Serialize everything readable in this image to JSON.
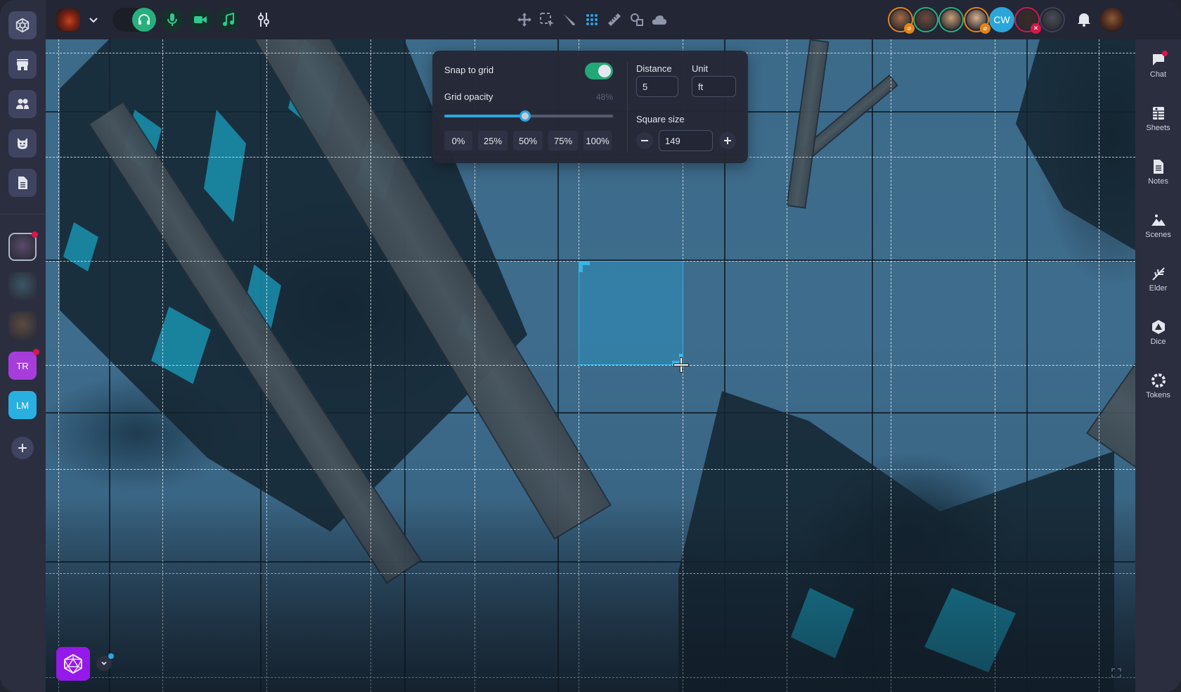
{
  "topbar": {
    "game_avatar": "game-avatar-dragon",
    "media": {
      "headphones": {
        "icon": "headphones-icon",
        "active": true
      },
      "microphone": {
        "icon": "microphone-icon",
        "active": false
      },
      "camera": {
        "icon": "video-camera-icon",
        "active": false
      },
      "music": {
        "icon": "music-note-icon",
        "active": false
      }
    },
    "mixer_icon": "sliders-icon",
    "tools": [
      {
        "name": "move",
        "icon": "move-icon",
        "active": false
      },
      {
        "name": "select",
        "icon": "select-icon",
        "active": false
      },
      {
        "name": "draw",
        "icon": "brush-icon",
        "active": false
      },
      {
        "name": "grid",
        "icon": "grid-icon",
        "active": true
      },
      {
        "name": "measure",
        "icon": "ruler-icon",
        "active": false
      },
      {
        "name": "shapes",
        "icon": "shapes-icon",
        "active": false
      },
      {
        "name": "fog",
        "icon": "cloud-icon",
        "active": false
      }
    ],
    "players": [
      {
        "type": "photo",
        "ring": "#e3841a",
        "status": "mic-muted",
        "badge_color": "#e3841a"
      },
      {
        "type": "photo",
        "ring": "#27b07e",
        "status": "speaking"
      },
      {
        "type": "photo",
        "ring": "#27b07e",
        "status": "speaking"
      },
      {
        "type": "photo",
        "ring": "#e3841a",
        "status": "mic-muted",
        "badge_color": "#e3841a"
      },
      {
        "type": "initials",
        "initials": "CW",
        "ring": "#2aa6d9"
      },
      {
        "type": "photo",
        "ring": "#d8174a",
        "status": "sound-muted",
        "badge_color": "#d8174a"
      },
      {
        "type": "photo",
        "ring": "#3e4258",
        "status": "offline"
      }
    ],
    "bell_icon": "bell-icon",
    "current_user_avatar": "avatar"
  },
  "left_sidebar": {
    "nav": [
      {
        "name": "store",
        "icon": "store-icon"
      },
      {
        "name": "players",
        "icon": "users-icon"
      },
      {
        "name": "monsters",
        "icon": "monster-icon"
      },
      {
        "name": "documents",
        "icon": "document-icon"
      }
    ],
    "characters": [
      {
        "kind": "portrait",
        "selected": true,
        "notification": true,
        "color": "#5a4a6a"
      },
      {
        "kind": "portrait",
        "selected": false,
        "notification": false,
        "color": "#3b5666"
      },
      {
        "kind": "portrait",
        "selected": false,
        "notification": false,
        "color": "#5b4a40"
      },
      {
        "kind": "initials",
        "initials": "TR",
        "color": "#a63ddb",
        "notification": true
      },
      {
        "kind": "initials",
        "initials": "LM",
        "color": "#2ab0e0",
        "notification": false
      }
    ],
    "add_label": "+"
  },
  "right_sidebar": {
    "items": [
      {
        "label": "Chat",
        "icon": "chat-icon",
        "notification": true
      },
      {
        "label": "Sheets",
        "icon": "sheets-icon",
        "notification": false
      },
      {
        "label": "Notes",
        "icon": "notes-icon",
        "notification": false
      },
      {
        "label": "Scenes",
        "icon": "scenes-icon",
        "notification": false
      },
      {
        "label": "Elder",
        "icon": "elder-icon",
        "notification": false
      },
      {
        "label": "Dice",
        "icon": "dice-icon",
        "notification": false
      },
      {
        "label": "Tokens",
        "icon": "tokens-icon",
        "notification": false
      }
    ]
  },
  "grid_panel": {
    "snap_label": "Snap to grid",
    "snap_enabled": true,
    "opacity_label": "Grid opacity",
    "opacity_value_text": "48%",
    "opacity_value": 0.48,
    "presets": [
      "0%",
      "25%",
      "50%",
      "75%",
      "100%"
    ],
    "distance_label": "Distance",
    "distance_value": "5",
    "unit_label": "Unit",
    "unit_value": "ft",
    "square_size_label": "Square size",
    "square_size_value": "149",
    "decrement_icon": "minus-icon",
    "increment_icon": "plus-icon"
  },
  "map": {
    "grid_enabled": true,
    "highlighted_cell": {
      "col": 5,
      "row": 2
    },
    "fullscreen_icon": "fullscreen-icon"
  },
  "dice_fab": {
    "icon": "d20-icon",
    "has_update": true
  }
}
